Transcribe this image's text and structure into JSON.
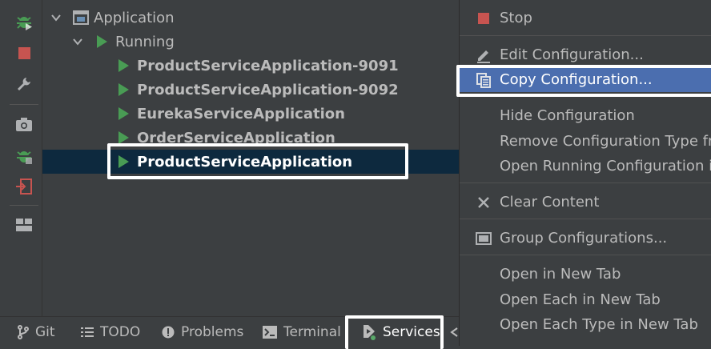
{
  "tree": {
    "root_label": "Application",
    "group_label": "Running",
    "items": [
      {
        "label": "ProductServiceApplication-9091"
      },
      {
        "label": "ProductServiceApplication-9092"
      },
      {
        "label": "EurekaServiceApplication"
      },
      {
        "label": "OrderServiceApplication"
      },
      {
        "label": "ProductServiceApplication"
      }
    ]
  },
  "sidebar": {
    "icons": [
      "debug-icon",
      "stop-icon",
      "wrench-icon",
      "camera-icon",
      "debug-icon",
      "exit-icon",
      "layout-icon"
    ]
  },
  "bottombar": {
    "items": [
      {
        "label": "Git",
        "icon": "git-branch-icon"
      },
      {
        "label": "TODO",
        "icon": "list-icon"
      },
      {
        "label": "Problems",
        "icon": "problems-icon"
      },
      {
        "label": "Terminal",
        "icon": "terminal-icon"
      },
      {
        "label": "Services",
        "icon": "services-icon"
      }
    ]
  },
  "menu": {
    "items": [
      {
        "label": "Stop",
        "icon": "stop-icon"
      },
      {
        "label": "Edit Configuration...",
        "icon": "pencil-icon"
      },
      {
        "label": "Copy Configuration...",
        "icon": "copy-icon"
      },
      {
        "label": "Hide Configuration",
        "icon": ""
      },
      {
        "label": "Remove Configuration Type from Services",
        "icon": ""
      },
      {
        "label": "Open Running Configuration in Editor",
        "icon": ""
      },
      {
        "label": "Clear Content",
        "icon": "close-icon"
      },
      {
        "label": "Group Configurations...",
        "icon": "folder-icon"
      },
      {
        "label": "Open in New Tab",
        "icon": ""
      },
      {
        "label": "Open Each in New Tab",
        "icon": ""
      },
      {
        "label": "Open Each Type in New Tab",
        "icon": ""
      }
    ]
  },
  "colors": {
    "run_green": "#499c54",
    "stop_red": "#c75450",
    "selection": "#0d293e",
    "menu_active": "#4b6eaf"
  }
}
